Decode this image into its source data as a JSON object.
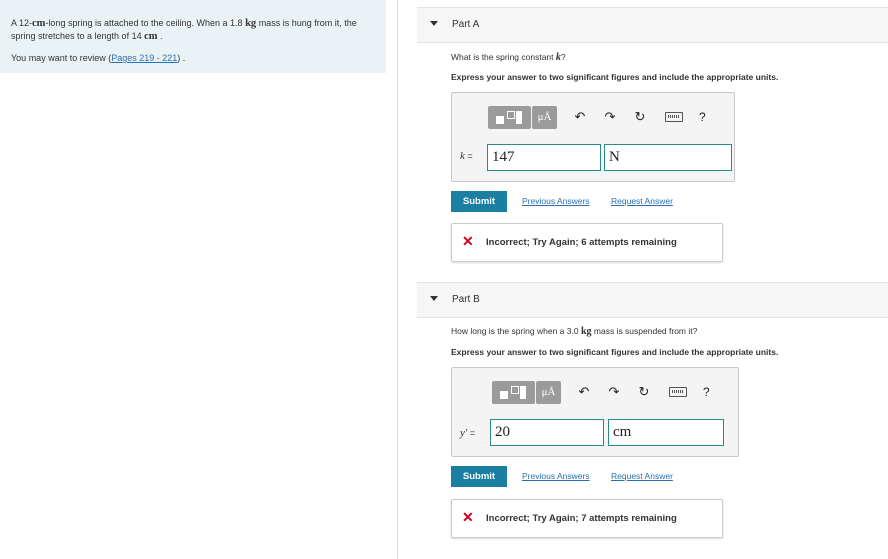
{
  "problem": {
    "text_pre": "A 12-",
    "text_cm": "cm",
    "text_mid": "-long spring is attached to the ceiling. When a 1.8",
    "text_kg": "kg",
    "text_mid2": "mass is hung from it, the spring stretches to a length of 14",
    "text_cm2": "cm",
    "text_end": ".",
    "review_prefix": "You may want to review (",
    "review_link": "Pages 219 - 221",
    "review_suffix": ") ."
  },
  "part_a": {
    "title": "Part A",
    "question_pre": "What is the spring constant",
    "question_var": "k",
    "question_post": "?",
    "instruction": "Express your answer to two significant figures and include the appropriate units.",
    "var_label": "k",
    "equals": "=",
    "value": "147",
    "unit": "N",
    "submit": "Submit",
    "previous_answers": "Previous Answers",
    "request_answer": "Request Answer",
    "feedback": "Incorrect; Try Again; 6 attempts remaining"
  },
  "part_b": {
    "title": "Part B",
    "question_pre": "How long is the spring when a 3.0",
    "question_unit": "kg",
    "question_post": "mass is suspended from it?",
    "instruction": "Express your answer to two significant figures and include the appropriate units.",
    "var_label": "y′",
    "equals": "=",
    "value": "20",
    "unit": "cm",
    "submit": "Submit",
    "previous_answers": "Previous Answers",
    "request_answer": "Request Answer",
    "feedback": "Incorrect; Try Again; 7 attempts remaining"
  },
  "toolbar": {
    "mu_label": "μÅ",
    "undo": "↶",
    "redo": "↷",
    "reset": "↻",
    "help": "?"
  }
}
